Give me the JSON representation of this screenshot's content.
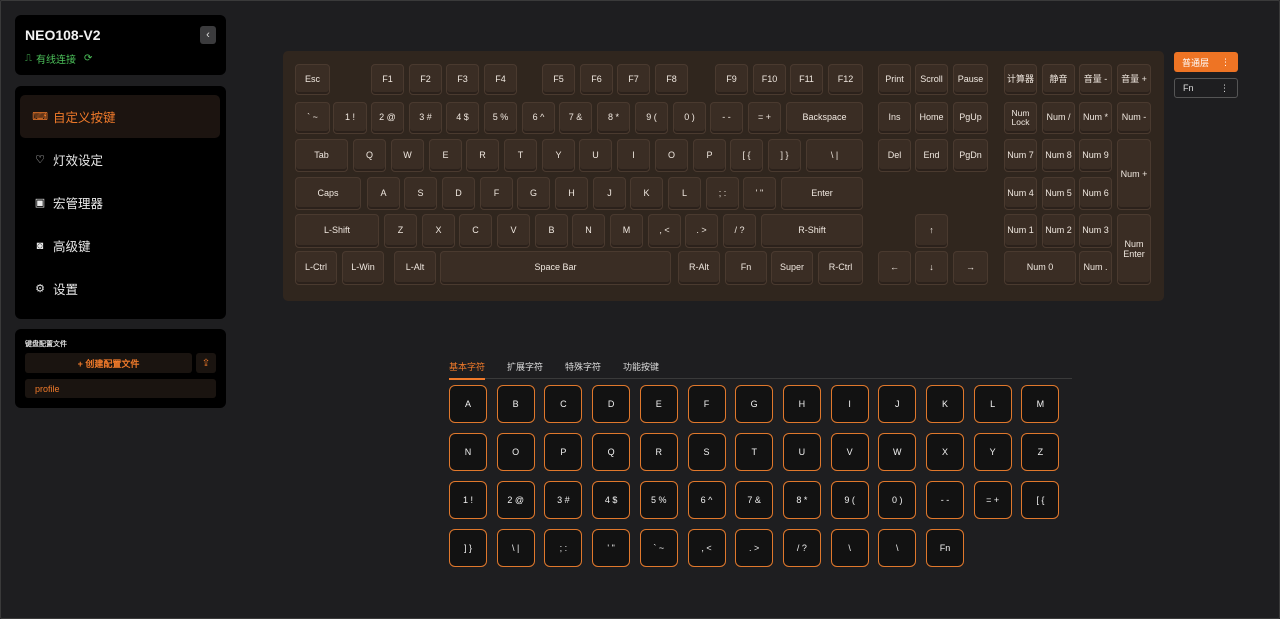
{
  "device": {
    "name": "NEO108-V2",
    "status": "有线连接",
    "status_glyph": "⟳",
    "collapse_glyph": "‹"
  },
  "nav": {
    "items": [
      {
        "label": "自定义按键",
        "icon": "keyboard-icon",
        "glyph": "⌨",
        "active": true
      },
      {
        "label": "灯效设定",
        "icon": "bulb-icon",
        "glyph": "♡",
        "active": false
      },
      {
        "label": "宏管理器",
        "icon": "macro-icon",
        "glyph": "▣",
        "active": false
      },
      {
        "label": "高级键",
        "icon": "advanced-key-icon",
        "glyph": "◙",
        "active": false
      },
      {
        "label": "设置",
        "icon": "gear-icon",
        "glyph": "⚙",
        "active": false
      }
    ]
  },
  "profiles": {
    "title": "键盘配置文件",
    "create_label": "+ 创建配置文件",
    "import_glyph": "⇪",
    "items": [
      "profile"
    ]
  },
  "layers": {
    "active_label": "普通层",
    "other_label": "Fn",
    "menu_glyph": "⋮"
  },
  "tabs": [
    "基本字符",
    "扩展字符",
    "特殊字符",
    "功能按键"
  ],
  "keyboard_keys": [
    "Esc",
    "F1",
    "F2",
    "F3",
    "F4",
    "F5",
    "F6",
    "F7",
    "F8",
    "F9",
    "F10",
    "F11",
    "F12",
    "Print",
    "Scroll",
    "Pause",
    "计算器",
    "静音",
    "音量 -",
    "音量 +",
    "` ~",
    "1 !",
    "2 @",
    "3 #",
    "4 $",
    "5 %",
    "6 ^",
    "7 &",
    "8 *",
    "9 (",
    "0 )",
    "- -",
    "= +",
    "Backspace",
    "Ins",
    "Home",
    "PgUp",
    "Num Lock",
    "Num /",
    "Num *",
    "Num -",
    "Tab",
    "Q",
    "W",
    "E",
    "R",
    "T",
    "Y",
    "U",
    "I",
    "O",
    "P",
    "[ {",
    "] }",
    "\\ |",
    "Del",
    "End",
    "PgDn",
    "Num 7",
    "Num 8",
    "Num 9",
    "Num +",
    "Caps",
    "A",
    "S",
    "D",
    "F",
    "G",
    "H",
    "J",
    "K",
    "L",
    "; :",
    "' \"",
    "Enter",
    "Num 4",
    "Num 5",
    "Num 6",
    "L-Shift",
    "Z",
    "X",
    "C",
    "V",
    "B",
    "N",
    "M",
    ", <",
    ". >",
    "/ ?",
    "R-Shift",
    "↑",
    "Num 1",
    "Num 2",
    "Num 3",
    "Num Enter",
    "L-Ctrl",
    "L-Win",
    "L-Alt",
    "Space Bar",
    "R-Alt",
    "Fn",
    "Super",
    "R-Ctrl",
    "←",
    "↓",
    "→",
    "Num 0",
    "Num ."
  ],
  "char_keys": [
    "A",
    "B",
    "C",
    "D",
    "E",
    "F",
    "G",
    "H",
    "I",
    "J",
    "K",
    "L",
    "M",
    "N",
    "O",
    "P",
    "Q",
    "R",
    "S",
    "T",
    "U",
    "V",
    "W",
    "X",
    "Y",
    "Z",
    "1 !",
    "2 @",
    "3 #",
    "4 $",
    "5 %",
    "6 ^",
    "7 &",
    "8 *",
    "9 (",
    "0 )",
    "- -",
    "= +",
    "[ {",
    "] }",
    "\\ |",
    "; :",
    "' \"",
    "` ~",
    ", <",
    ". >",
    "/ ?",
    "\\",
    "\\",
    "Fn"
  ],
  "colors": {
    "accent": "#ee7424",
    "connected": "#4cc25a",
    "keycap": "#3a2d24"
  }
}
